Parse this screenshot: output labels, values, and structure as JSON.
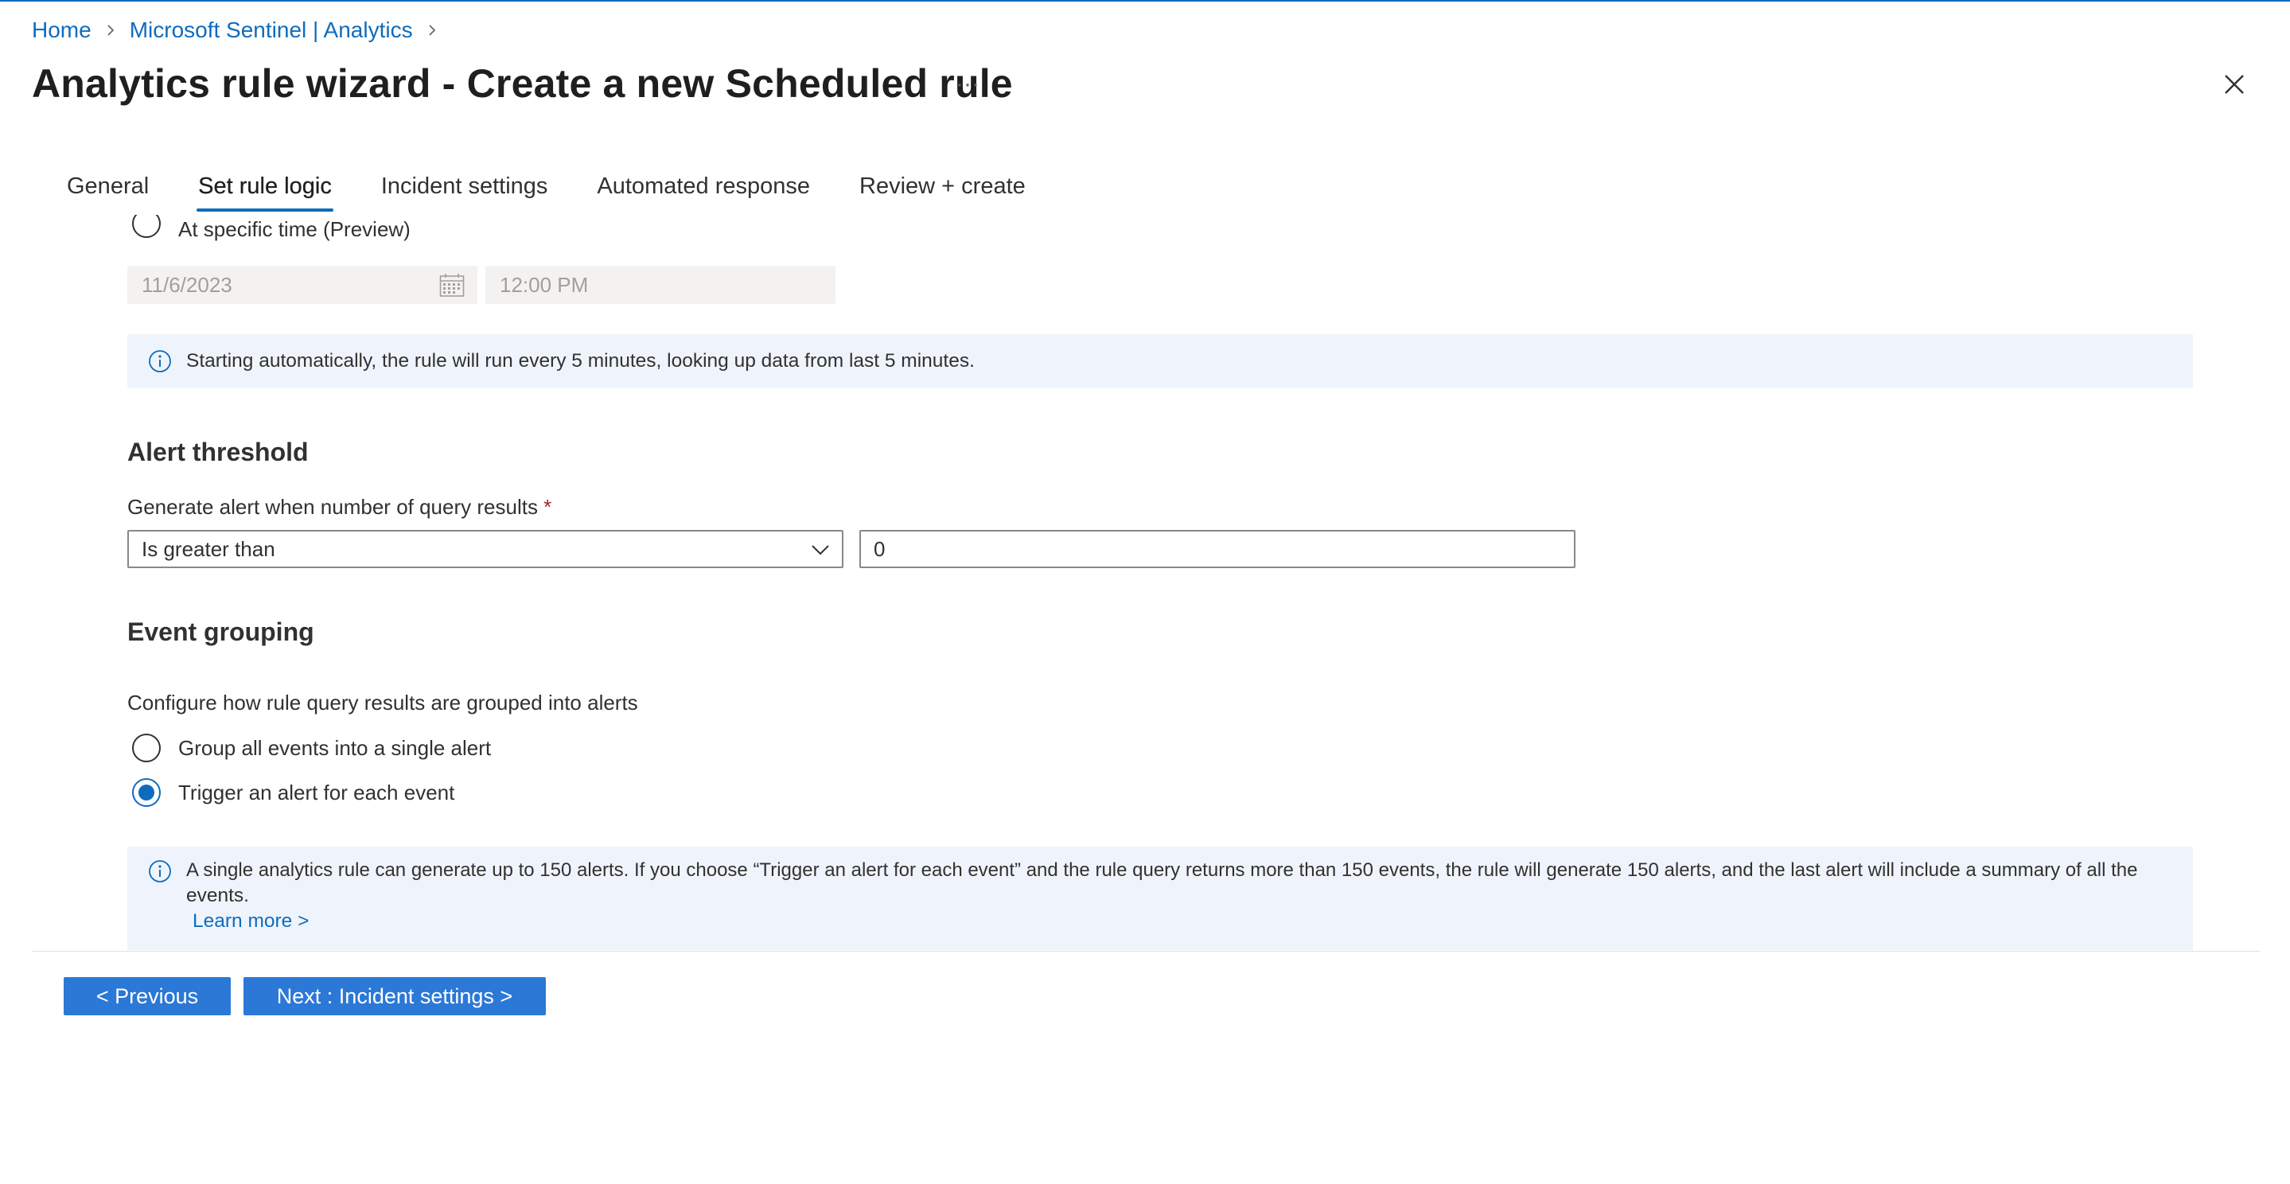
{
  "breadcrumb": {
    "items": [
      "Home",
      "Microsoft Sentinel | Analytics"
    ]
  },
  "page": {
    "title": "Analytics rule wizard - Create a new Scheduled rule",
    "more_label": "···"
  },
  "tabs": [
    {
      "label": "General",
      "active": false
    },
    {
      "label": "Set rule logic",
      "active": true
    },
    {
      "label": "Incident settings",
      "active": false
    },
    {
      "label": "Automated response",
      "active": false
    },
    {
      "label": "Review + create",
      "active": false
    }
  ],
  "schedule": {
    "specific_time_option": "At specific time (Preview)",
    "date_value": "11/6/2023",
    "time_value": "12:00 PM",
    "info_text": "Starting automatically, the rule will run every 5 minutes, looking up data from last 5 minutes."
  },
  "alert_threshold": {
    "title": "Alert threshold",
    "label": "Generate alert when number of query results",
    "required_mark": "*",
    "operator_value": "Is greater than",
    "threshold_value": "0"
  },
  "event_grouping": {
    "title": "Event grouping",
    "description": "Configure how rule query results are grouped into alerts",
    "options": [
      {
        "label": "Group all events into a single alert",
        "checked": false
      },
      {
        "label": "Trigger an alert for each event",
        "checked": true
      }
    ],
    "info_line1": "A single analytics rule can generate up to 150 alerts. If you choose “Trigger an alert for each event” and the rule query returns more than 150 events, the rule will generate 150 alerts, and the last alert will include a summary of all the",
    "info_line2": "events.",
    "learn_more": "Learn more >"
  },
  "footer": {
    "previous_label": "< Previous",
    "next_label": "Next : Incident settings >"
  },
  "colors": {
    "accent": "#0f6cbd",
    "button": "#2b78d6",
    "info_background": "#eff4fc"
  }
}
